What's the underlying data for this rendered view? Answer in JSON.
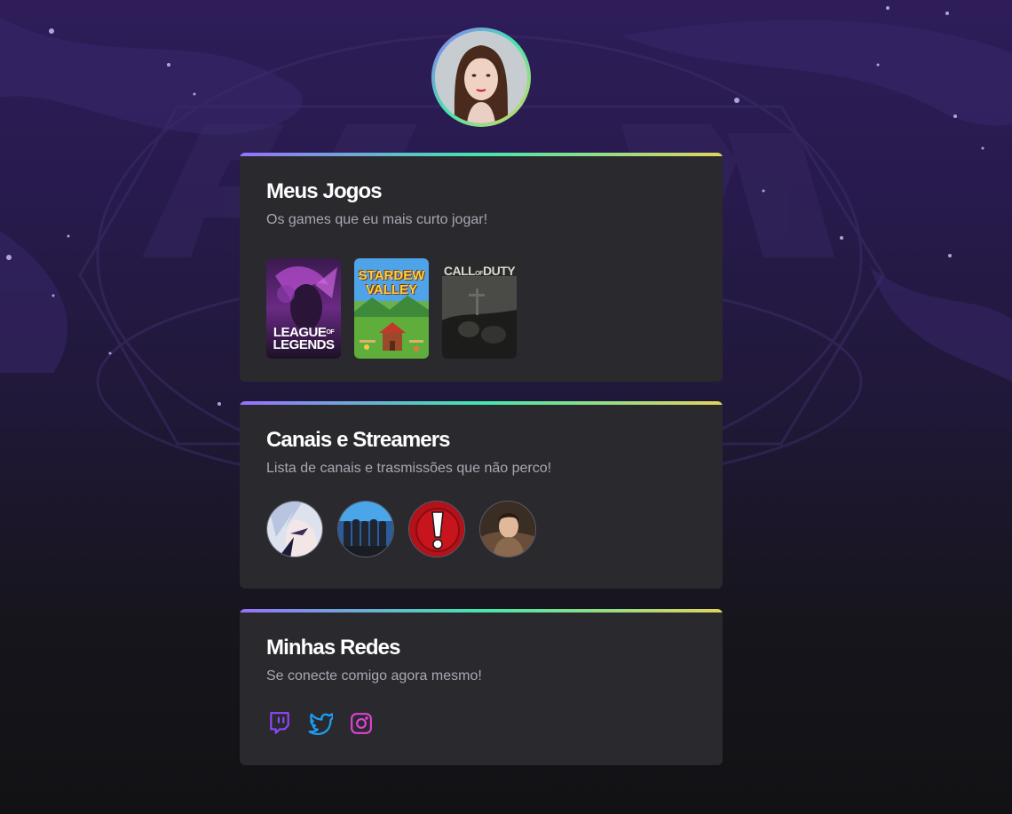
{
  "profile": {
    "avatar_alt": "profile-photo"
  },
  "games_card": {
    "title": "Meus Jogos",
    "subtitle": "Os games que eu mais curto jogar!",
    "games": [
      {
        "cover_line1": "LEAGUE",
        "cover_line2": "LEGENDS",
        "cover_of": "OF"
      },
      {
        "cover_line1": "STARDEW",
        "cover_line2": "VALLEY"
      },
      {
        "cover_line1": "CALL",
        "cover_of": "DUTY",
        "cover_mid": "OF"
      }
    ]
  },
  "streamers_card": {
    "title": "Canais e Streamers",
    "subtitle": "Lista de canais e trasmissões que não perco!"
  },
  "social_card": {
    "title": "Minhas Redes",
    "subtitle": "Se conecte comigo agora mesmo!",
    "links": [
      {
        "icon": "twitch-icon",
        "color": "#9147ff"
      },
      {
        "icon": "twitter-icon",
        "color": "#1d9bf0"
      },
      {
        "icon": "instagram-icon",
        "color": "#e042d8"
      }
    ]
  },
  "colors": {
    "card_bg": "#29292e",
    "gradient": [
      "#9572fc",
      "#43e7ad",
      "#e2d45c"
    ],
    "title": "#ffffff",
    "subtitle": "#a8a8b3"
  }
}
